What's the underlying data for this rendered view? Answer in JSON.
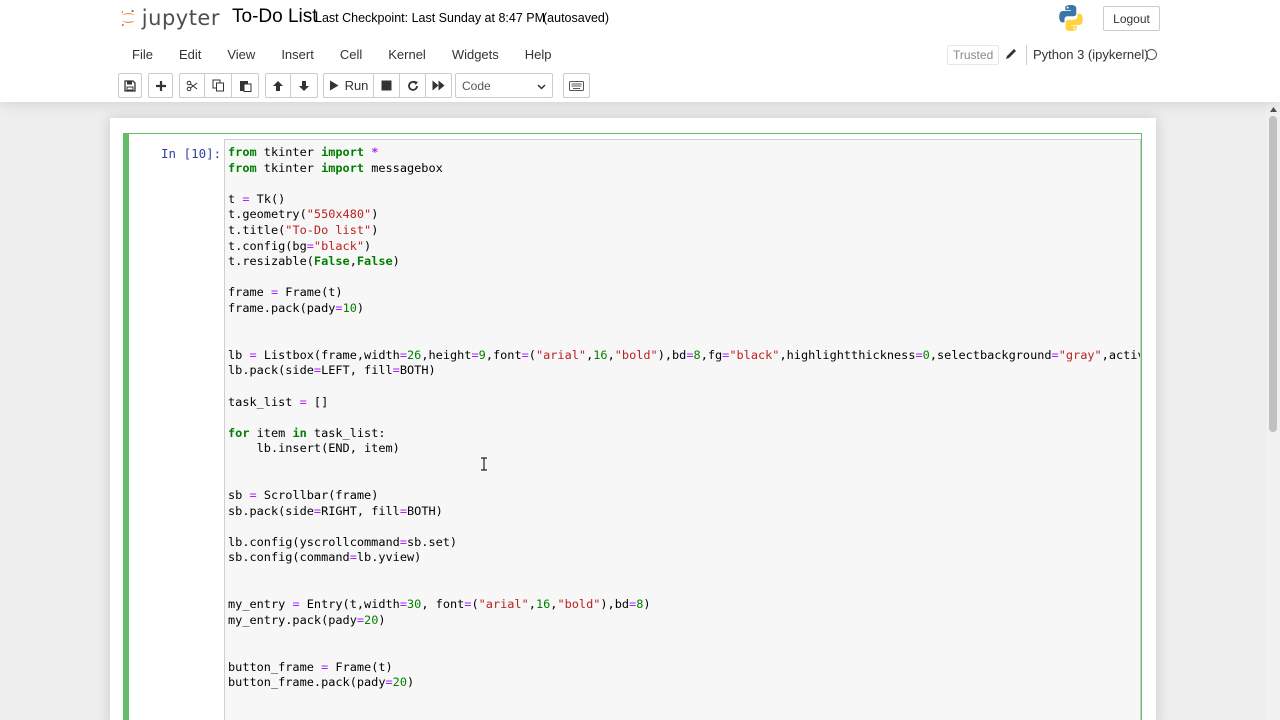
{
  "header": {
    "logo_text": "jupyter",
    "notebook_name": "To-Do List",
    "checkpoint": "Last Checkpoint: Last Sunday at 8:47 PM",
    "autosave": "(autosaved)",
    "logout_label": "Logout"
  },
  "menubar": {
    "items": [
      "File",
      "Edit",
      "View",
      "Insert",
      "Cell",
      "Kernel",
      "Widgets",
      "Help"
    ],
    "trusted_label": "Trusted",
    "kernel_name": "Python 3 (ipykernel)"
  },
  "toolbar": {
    "run_label": "Run",
    "cell_type": "Code"
  },
  "cell": {
    "prompt": "In [10]:",
    "code_lines": [
      "from tkinter import *",
      "from tkinter import messagebox",
      "",
      "t = Tk()",
      "t.geometry(\"550x480\")",
      "t.title(\"To-Do list\")",
      "t.config(bg=\"black\")",
      "t.resizable(False,False)",
      "",
      "frame = Frame(t)",
      "frame.pack(pady=10)",
      "",
      "",
      "lb = Listbox(frame,width=26,height=9,font=(\"arial\",16,\"bold\"),bd=8,fg=\"black\",highlightthickness=0,selectbackground=\"gray\",activestyle=\"none\")",
      "lb.pack(side=LEFT, fill=BOTH)",
      "",
      "task_list = []",
      "",
      "for item in task_list:",
      "    lb.insert(END, item)",
      "",
      "",
      "sb = Scrollbar(frame)",
      "sb.pack(side=RIGHT, fill=BOTH)",
      "",
      "lb.config(yscrollcommand=sb.set)",
      "sb.config(command=lb.yview)",
      "",
      "",
      "my_entry = Entry(t,width=30, font=(\"arial\",16,\"bold\"),bd=8)",
      "my_entry.pack(pady=20)",
      "",
      "",
      "button_frame = Frame(t)",
      "button_frame.pack(pady=20)"
    ]
  },
  "colors": {
    "selected_cell_border": "#66bb6a",
    "prompt_color": "#303f9f",
    "keyword": "#008000",
    "string": "#ba2121"
  }
}
